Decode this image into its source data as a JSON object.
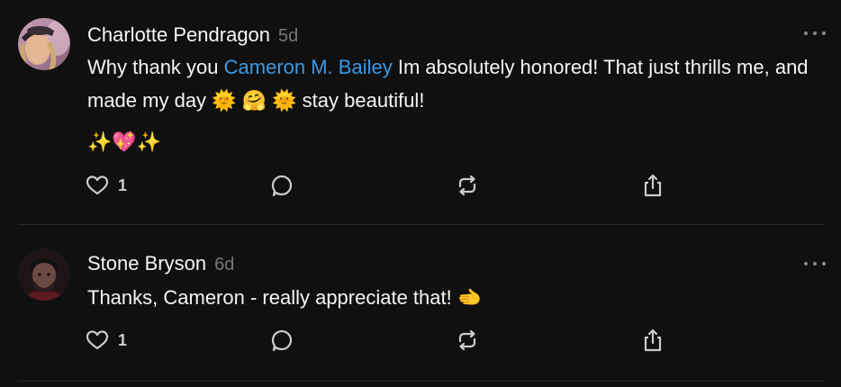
{
  "colors": {
    "background": "#101010",
    "text": "#f3f5f7",
    "muted": "#777777",
    "mention": "#3a9ae6",
    "icon": "#cccccc"
  },
  "comments": [
    {
      "author": "Charlotte Pendragon",
      "time": "5d",
      "text_before": "Why thank you ",
      "mention": "Cameron M. Bailey",
      "text_after": " Im absolutely honored! That just thrills me, and made my day 🌞 🤗 🌞 stay beautiful!",
      "extra_line": "✨💖✨",
      "likes": "1",
      "icons": [
        "heart-icon",
        "comment-icon",
        "repost-icon",
        "share-icon",
        "more-icon"
      ]
    },
    {
      "author": "Stone Bryson",
      "time": "6d",
      "text": "Thanks, Cameron - really appreciate that! 🫲",
      "likes": "1",
      "icons": [
        "heart-icon",
        "comment-icon",
        "repost-icon",
        "share-icon",
        "more-icon"
      ]
    }
  ]
}
